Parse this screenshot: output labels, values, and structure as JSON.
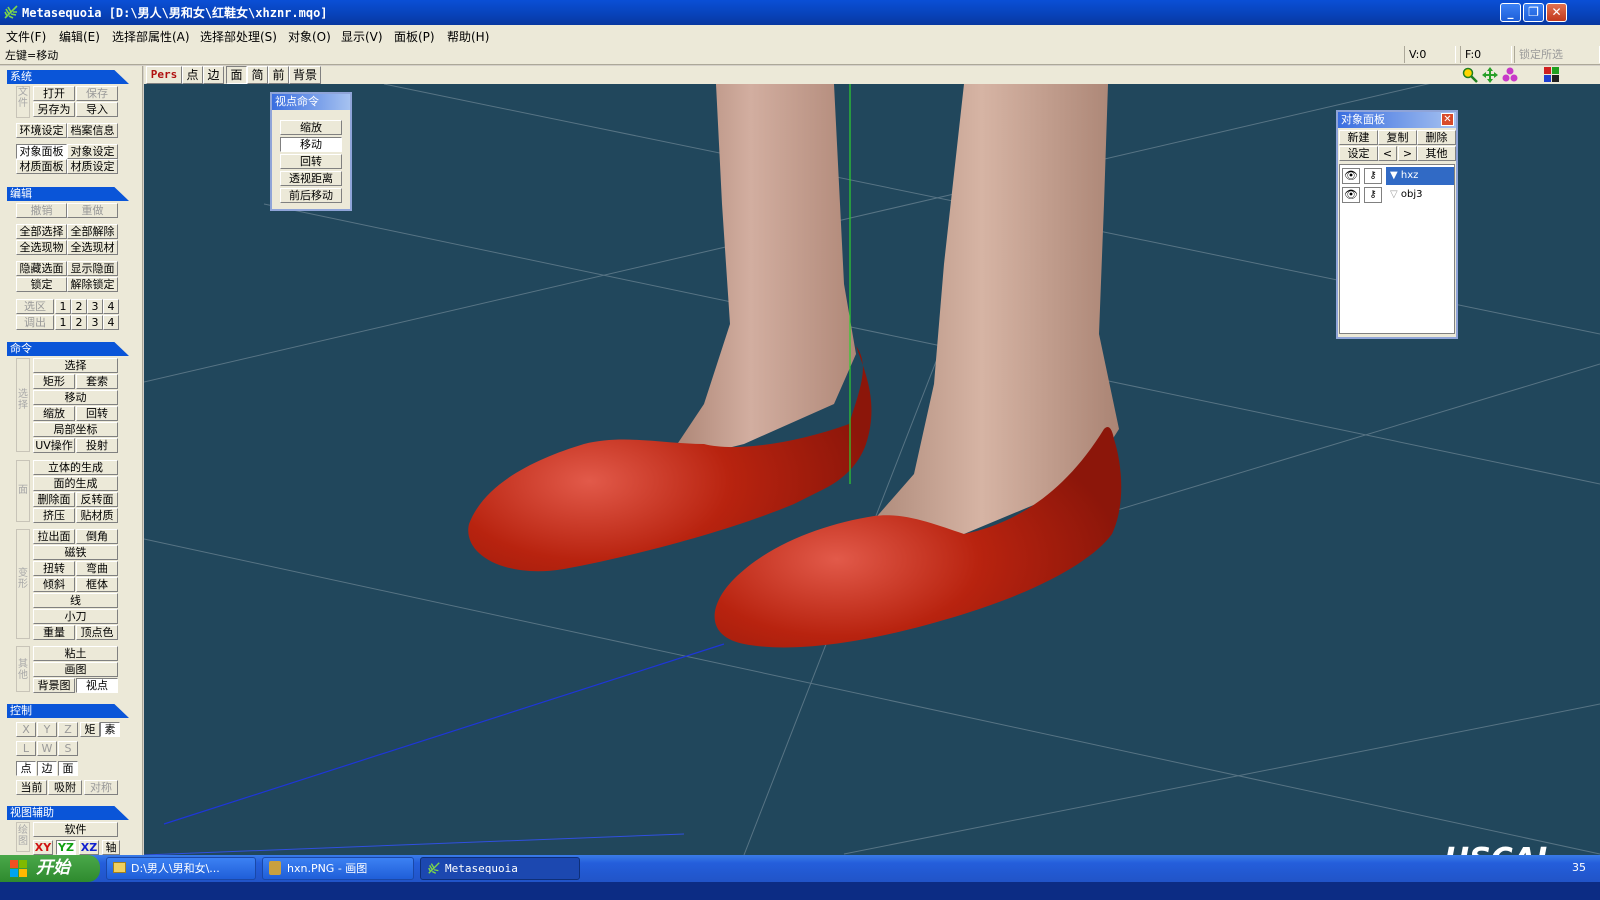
{
  "window": {
    "title": "Metasequoia [D:\\男人\\男和女\\红鞋女\\xhznr.mqo]",
    "minimize_glyph": "_",
    "restore_glyph": "❐",
    "close_glyph": "✕"
  },
  "menu": [
    "文件(F)",
    "编辑(E)",
    "选择部属性(A)",
    "选择部处理(S)",
    "对象(O)",
    "显示(V)",
    "面板(P)",
    "帮助(H)"
  ],
  "status": {
    "hint": "左键=移动",
    "v_count": "V:0",
    "f_count": "F:0",
    "lock_selection": "锁定所选"
  },
  "left": {
    "system": {
      "header": "系统",
      "side_label": "文件",
      "open": "打开",
      "save": "保存",
      "save_as": "另存为",
      "import": "导入",
      "env_settings": "环境设定",
      "file_info": "档案信息",
      "object_panel": "对象面板",
      "object_settings": "对象设定",
      "material_panel": "材质面板",
      "material_settings": "材质设定"
    },
    "edit": {
      "header": "编辑",
      "undo": "撤销",
      "redo": "重做",
      "select_all": "全部选择",
      "deselect_all": "全部解除",
      "select_current_object": "全选现物",
      "select_current_material": "全选现材",
      "hide_selected_faces": "隐藏选面",
      "show_hidden_faces": "显示隐面",
      "lock": "锁定",
      "unlock": "解除锁定",
      "selection_slot": "选区",
      "recall_slot": "调出",
      "slots": [
        "1",
        "2",
        "3",
        "4"
      ]
    },
    "command": {
      "header": "命令",
      "side_label_select": "选择",
      "select": "选择",
      "rect": "矩形",
      "lasso": "套索",
      "move": "移动",
      "scale": "缩放",
      "rotate": "回转",
      "local_coords": "局部坐标",
      "uv_op": "UV操作",
      "projection": "投射",
      "side_label_face": "面",
      "create_solid": "立体的生成",
      "create_face": "面的生成",
      "delete_face": "删除面",
      "flip_face": "反转面",
      "extrude": "挤压",
      "paint_material": "贴材质",
      "side_label_deform": "变形",
      "pull_face": "拉出面",
      "bevel": "倒角",
      "magnet": "磁铁",
      "twist": "扭转",
      "bend": "弯曲",
      "tilt": "倾斜",
      "frame": "框体",
      "line": "线",
      "knife": "小刀",
      "weight": "重量",
      "vertex_color": "顶点色",
      "side_label_misc": "其他",
      "sculpt": "粘土",
      "paint": "画图",
      "background_image": "背景图",
      "viewpoint": "视点"
    },
    "control": {
      "header": "控制",
      "x": "X",
      "y": "Y",
      "z": "Z",
      "matrix": "矩",
      "element": "素",
      "l": "L",
      "w": "W",
      "s": "S",
      "point": "点",
      "edge": "边",
      "face": "面",
      "current": "当前",
      "snap": "吸附",
      "symmetry": "对称"
    },
    "view_aux": {
      "header": "视图辅助",
      "side_label": "绘图",
      "software": "软件",
      "xy": "XY",
      "yz": "YZ",
      "xz": "XZ",
      "axis": "轴"
    }
  },
  "viewport_toolbar": {
    "pers": "Pers",
    "point": "点",
    "edge": "边",
    "face": "面",
    "simple": "简",
    "front": "前",
    "background": "背景"
  },
  "view_command_panel": {
    "title": "视点命令",
    "buttons": [
      "缩放",
      "移动",
      "回转",
      "透视距离",
      "前后移动"
    ]
  },
  "object_panel": {
    "title": "对象面板",
    "new": "新建",
    "duplicate": "复制",
    "delete": "删除",
    "settings": "设定",
    "prev": "<",
    "next": ">",
    "other": "其他",
    "objects": [
      {
        "name": "hxz",
        "selected": true
      },
      {
        "name": "obj3",
        "selected": false
      }
    ]
  },
  "taskbar": {
    "start": "开始",
    "tasks": [
      {
        "label": "D:\\男人\\男和女\\..."
      },
      {
        "label": "hxn.PNG - 画图"
      },
      {
        "label": "Metasequoia"
      }
    ],
    "clock_partial": "35"
  },
  "watermark": "HSCAL",
  "colors": {
    "viewport_bg": "#21475c",
    "shoe_red": "#b3210e",
    "skin": "#c9a595",
    "section_header": "#0a55d8"
  }
}
